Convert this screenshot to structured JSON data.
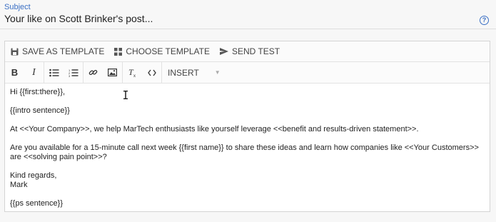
{
  "subject": {
    "label": "Subject",
    "value": "Your like on Scott Brinker's post..."
  },
  "toolbar": {
    "save_template": "SAVE AS TEMPLATE",
    "choose_template": "CHOOSE TEMPLATE",
    "send_test": "SEND TEST",
    "insert_select": "INSERT",
    "format_buttons": [
      "bold-icon",
      "italic-icon",
      "bullet-list-icon",
      "numbered-list-icon",
      "link-icon",
      "image-icon",
      "clear-format-icon",
      "code-icon"
    ]
  },
  "email_body": {
    "greeting": "Hi {{first:there}},",
    "intro": "{{intro sentence}}",
    "para1": "At <<Your Company>>, we help MarTech enthusiasts like yourself leverage <<benefit and results-driven statement>>.",
    "para2": "Are you available for a 15-minute call next week {{first name}} to share these ideas and learn how companies like <<Your Customers>> are <<solving pain point>>?",
    "signoff": "Kind regards,",
    "signature": "Mark",
    "ps": "{{ps sentence}}"
  },
  "colors": {
    "accent": "#3a6fc4",
    "border": "#d4d4d4"
  }
}
